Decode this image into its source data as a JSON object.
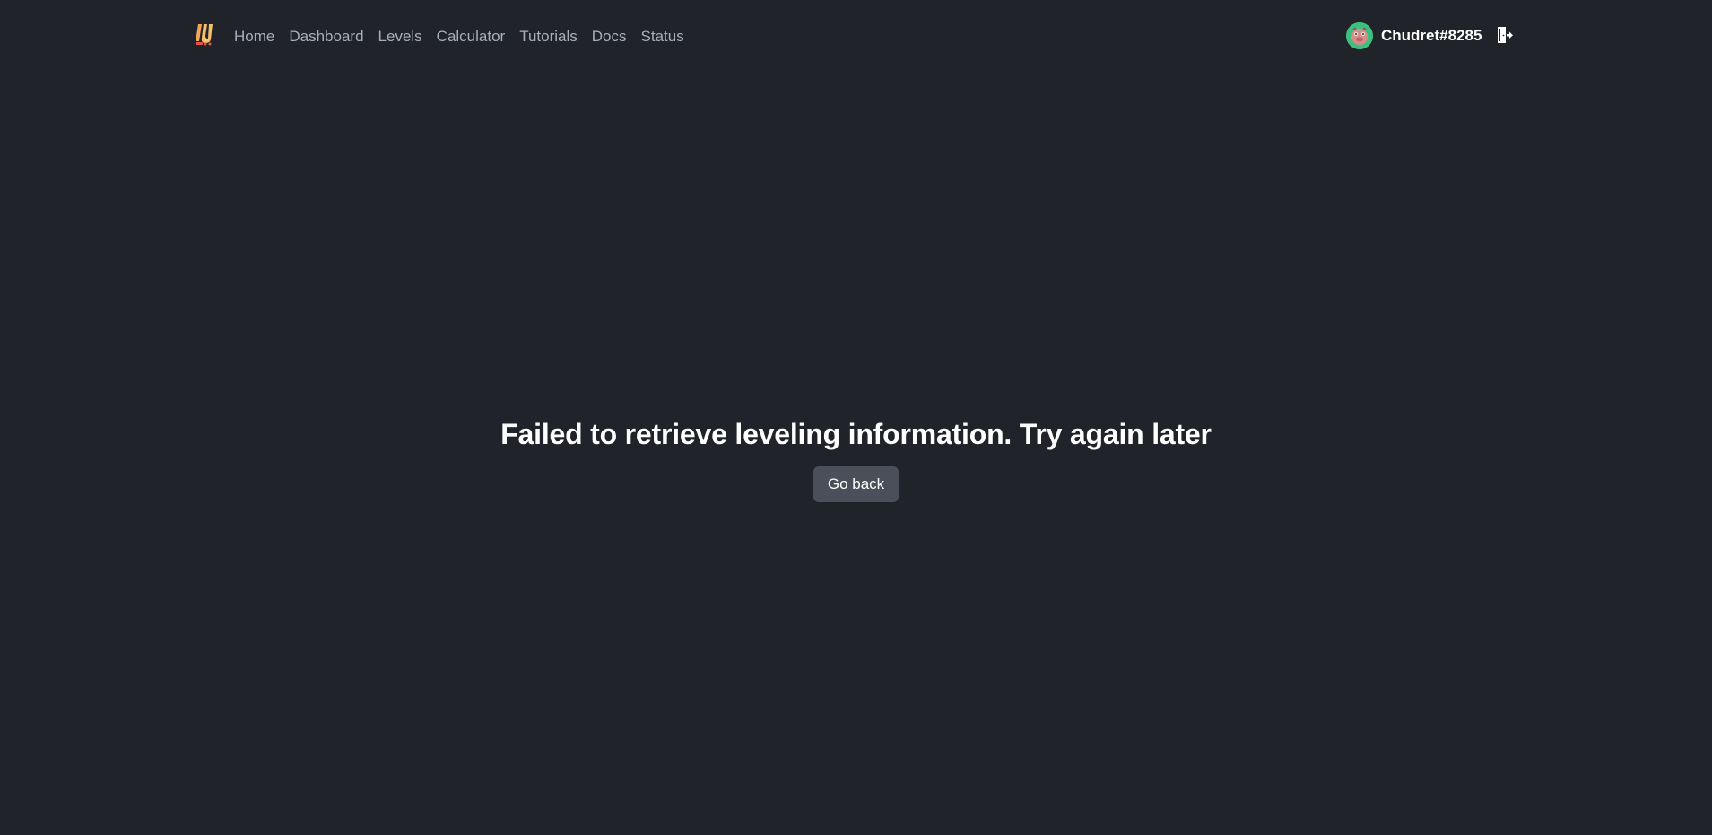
{
  "navbar": {
    "logo_text": "LU",
    "links": [
      {
        "label": "Home"
      },
      {
        "label": "Dashboard"
      },
      {
        "label": "Levels"
      },
      {
        "label": "Calculator"
      },
      {
        "label": "Tutorials"
      },
      {
        "label": "Docs"
      },
      {
        "label": "Status"
      }
    ],
    "user": {
      "name": "Chudret#8285",
      "avatar_icon": "avatar-icon"
    },
    "logout_icon": "logout-icon"
  },
  "main": {
    "error_message": "Failed to retrieve leveling information. Try again later",
    "back_button": "Go back"
  },
  "colors": {
    "background": "#202329",
    "nav_link": "#a9afb9",
    "button_bg": "#4a4f5a",
    "text": "#ffffff"
  }
}
